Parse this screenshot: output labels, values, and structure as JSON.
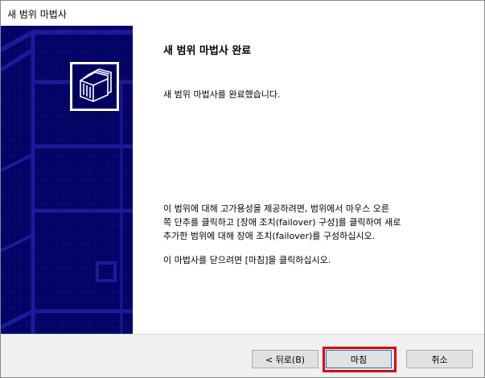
{
  "window": {
    "title": "새 범위 마법사"
  },
  "banner": {
    "icon": "folders-icon",
    "background_color": "#000060"
  },
  "content": {
    "heading": "새 범위 마법사 완료",
    "complete_message": "새 범위 마법사를 완료했습니다.",
    "info_line1": "이 범위에 대해 고가용성을 제공하려면, 범위에서 마우스 오른",
    "info_line2": "쪽 단추를 클릭하고 [장애 조치(failover) 구성]를 클릭하여 새로",
    "info_line3": "추가한 범위에 대해 장애 조치(failover)를 구성하십시오.",
    "close_message": "이 마법사를 닫으려면 [마침]을 클릭하십시오."
  },
  "buttons": {
    "back": "< 뒤로(B)",
    "finish": "마침",
    "cancel": "취소"
  },
  "colors": {
    "highlight": "#e00000",
    "focus": "#0078d7"
  }
}
